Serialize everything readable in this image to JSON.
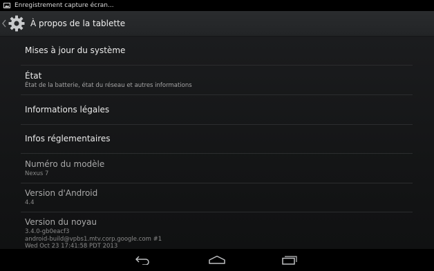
{
  "status_bar": {
    "notification_icon": "image-icon",
    "notification_text": "Enregistrement capture écran..."
  },
  "action_bar": {
    "up_icon": "chevron-left-icon",
    "app_icon": "gear-icon",
    "title": "À propos de la tablette"
  },
  "preferences": [
    {
      "title": "Mises à jour du système",
      "summary": ""
    },
    {
      "title": "État",
      "summary": "État de la batterie, état du réseau et autres informations"
    },
    {
      "title": "Informations légales",
      "summary": ""
    },
    {
      "title": "Infos réglementaires",
      "summary": ""
    },
    {
      "title": "Numéro du modèle",
      "summary": "Nexus 7"
    },
    {
      "title": "Version d'Android",
      "summary": "4.4"
    },
    {
      "title": "Version du noyau",
      "summary_lines": [
        "3.4.0-gb0eacf3",
        "android-build@vpbs1.mtv.corp.google.com #1",
        "Wed Oct 23 17:41:58 PDT 2013"
      ]
    }
  ],
  "nav_bar": {
    "back_icon": "back-icon",
    "home_icon": "home-icon",
    "recents_icon": "recent-apps-icon"
  },
  "colors": {
    "background": "#141516",
    "action_bar": "#262829",
    "divider": "#2c2d2f",
    "text_primary": "#ececec",
    "text_secondary": "#a6a6a6"
  }
}
